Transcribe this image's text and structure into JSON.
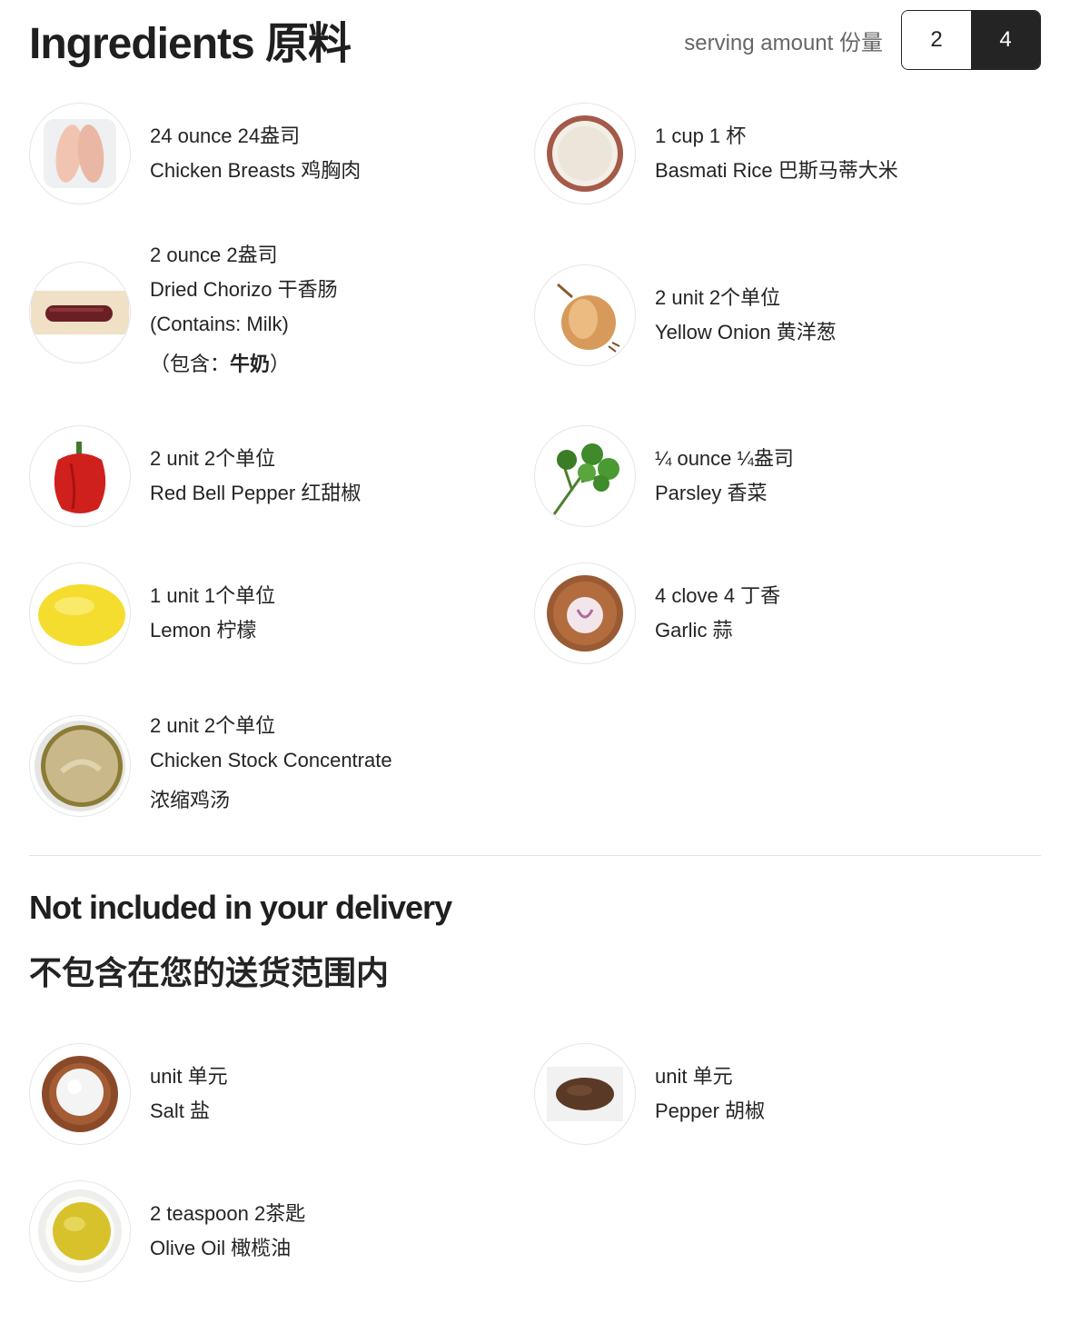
{
  "header": {
    "title": "Ingredients 原料",
    "serving_label": "serving amount 份量",
    "serving_options": [
      "2",
      "4"
    ],
    "serving_selected": "4"
  },
  "ingredients": [
    {
      "amount": "24 ounce  24盎司",
      "name": "Chicken Breasts  鸡胸肉",
      "icon": "chicken-breast-icon"
    },
    {
      "amount": "1 cup  1 杯",
      "name": "Basmati Rice  巴斯马蒂大米",
      "icon": "rice-icon"
    },
    {
      "amount": "2 ounce  2盎司",
      "name": "Dried Chorizo  干香肠",
      "allergen": "(Contains: Milk)",
      "allergen_cn_prefix": "（包含：",
      "allergen_cn_bold": "牛奶",
      "allergen_cn_suffix": "）",
      "icon": "chorizo-icon"
    },
    {
      "amount": "2 unit  2个单位",
      "name": "Yellow Onion  黄洋葱",
      "icon": "onion-icon"
    },
    {
      "amount": "2 unit  2个单位",
      "name": "Red Bell Pepper  红甜椒",
      "icon": "bell-pepper-icon"
    },
    {
      "amount": "¼ ounce  ¼盎司",
      "name": "Parsley  香菜",
      "icon": "parsley-icon"
    },
    {
      "amount": "1 unit  1个单位",
      "name": "Lemon  柠檬",
      "icon": "lemon-icon"
    },
    {
      "amount": "4 clove  4 丁香",
      "name": "Garlic  蒜",
      "icon": "garlic-icon"
    },
    {
      "amount": "2 unit  2个单位",
      "name": "Chicken Stock Concentrate",
      "name_cn": "浓缩鸡汤",
      "icon": "chicken-stock-icon"
    }
  ],
  "not_included": {
    "title": "Not included in your delivery",
    "title_cn": "不包含在您的送货范围内",
    "items": [
      {
        "amount": "unit  单元",
        "name": "Salt  盐",
        "icon": "salt-icon"
      },
      {
        "amount": "unit  单元",
        "name": "Pepper  胡椒",
        "icon": "pepper-icon"
      },
      {
        "amount": "2 teaspoon  2茶匙",
        "name": "Olive Oil  橄榄油",
        "icon": "olive-oil-icon"
      }
    ]
  }
}
